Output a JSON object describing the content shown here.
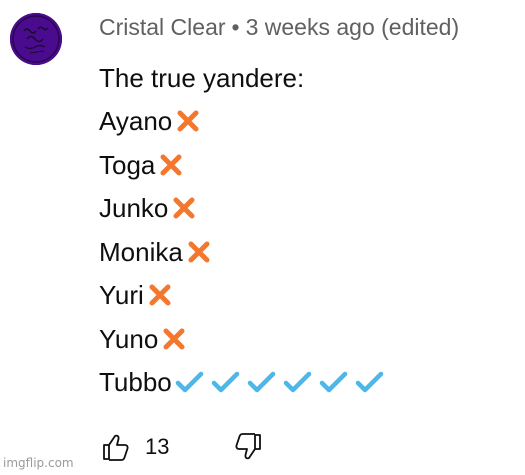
{
  "comment": {
    "author": "Cristal Clear",
    "separator": "•",
    "time": "3 weeks ago (edited)",
    "lines": [
      {
        "text": "The true yandere:",
        "mark": "none"
      },
      {
        "text": "Ayano",
        "mark": "cross"
      },
      {
        "text": "Toga",
        "mark": "cross"
      },
      {
        "text": "Junko",
        "mark": "cross"
      },
      {
        "text": "Monika",
        "mark": "cross"
      },
      {
        "text": "Yuri",
        "mark": "cross"
      },
      {
        "text": "Yuno",
        "mark": "cross"
      },
      {
        "text": "Tubbo",
        "mark": "checks",
        "check_count": 6
      }
    ],
    "likes": "13"
  },
  "icons": {
    "avatar": "avatar-icon",
    "cross": "cross-mark-icon",
    "check": "check-mark-icon",
    "like": "thumbs-up-icon",
    "dislike": "thumbs-down-icon"
  },
  "colors": {
    "cross": "#f4772e",
    "check": "#4cb7e8",
    "meta_text": "#606060",
    "body_text": "#0f0f0f",
    "avatar_bg": "#4a0b8f"
  },
  "watermark": "imgflip.com"
}
